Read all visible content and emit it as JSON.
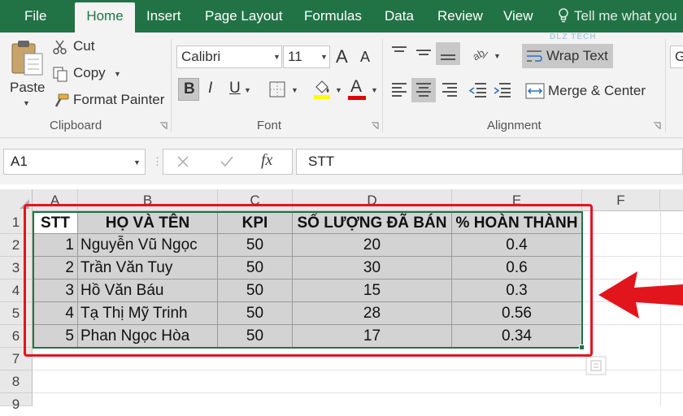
{
  "tabs": [
    {
      "label": "File",
      "active": false
    },
    {
      "label": "Home",
      "active": true
    },
    {
      "label": "Insert",
      "active": false
    },
    {
      "label": "Page Layout",
      "active": false
    },
    {
      "label": "Formulas",
      "active": false
    },
    {
      "label": "Data",
      "active": false
    },
    {
      "label": "Review",
      "active": false
    },
    {
      "label": "View",
      "active": false
    }
  ],
  "tell_me": "Tell me what you",
  "clipboard": {
    "paste": "Paste",
    "cut": "Cut",
    "copy": "Copy",
    "format_painter": "Format Painter",
    "label": "Clipboard"
  },
  "font": {
    "name": "Calibri",
    "size": "11",
    "label": "Font",
    "bold": "B",
    "italic": "I",
    "underline": "U",
    "grow": "A",
    "shrink": "A",
    "font_color": "A",
    "highlight_color": "#ffff00",
    "text_color": "#e00000"
  },
  "alignment": {
    "wrap_text": "Wrap Text",
    "merge_center": "Merge & Center",
    "label": "Alignment"
  },
  "watermark": "DLZ TECH",
  "name_box": "A1",
  "fx": "fx",
  "formula_value": "STT",
  "columns": [
    "A",
    "B",
    "C",
    "D",
    "E",
    "F"
  ],
  "rows": [
    "1",
    "2",
    "3",
    "4",
    "5",
    "6",
    "7",
    "8",
    "9"
  ],
  "table": {
    "headers": [
      "STT",
      "HỌ VÀ TÊN",
      "KPI",
      "SỐ LƯỢNG ĐÃ BÁN",
      "% HOÀN THÀNH"
    ],
    "rows": [
      [
        "1",
        "Nguyễn Vũ Ngọc",
        "50",
        "20",
        "0.4"
      ],
      [
        "2",
        "Trần Văn Tuy",
        "50",
        "30",
        "0.6"
      ],
      [
        "3",
        "Hồ Văn Báu",
        "50",
        "15",
        "0.3"
      ],
      [
        "4",
        "Tạ Thị Mỹ Trinh",
        "50",
        "28",
        "0.56"
      ],
      [
        "5",
        "Phan Ngọc Hòa",
        "50",
        "17",
        "0.34"
      ]
    ]
  },
  "colors": {
    "excel_green": "#217346",
    "annotation_red": "#e3151c",
    "selection_gray": "#d3d3d3"
  }
}
